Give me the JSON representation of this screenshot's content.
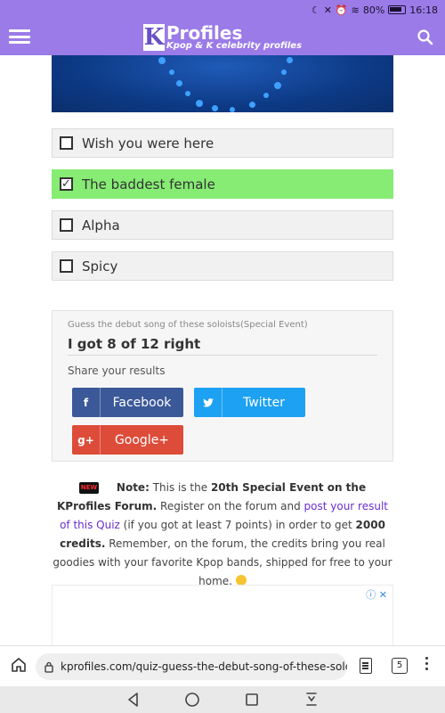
{
  "statusbar": {
    "battery": "80%",
    "time": "16:18"
  },
  "header": {
    "logo_letter": "K",
    "logo_name": "Profiles",
    "logo_tagline": "Kpop & K celebrity profiles"
  },
  "options": [
    {
      "label": "Wish you were here",
      "checked": false
    },
    {
      "label": "The baddest female",
      "checked": true
    },
    {
      "label": "Alpha",
      "checked": false
    },
    {
      "label": "Spicy",
      "checked": false
    }
  ],
  "result": {
    "quiz_title": "Guess the debut song of these soloists(Special Event)",
    "score_text": "I got 8 of 12 right",
    "share_label": "Share your results",
    "buttons": {
      "facebook": "Facebook",
      "twitter": "Twitter",
      "googleplus": "Google+"
    }
  },
  "note": {
    "badge": "NEW",
    "lead": "Note:",
    "text1": " This is the ",
    "bold1": "20th Special Event on the KProfiles Forum.",
    "text2": " Register on the forum and ",
    "link": "post your result of this Quiz",
    "text3": " (if you got at least 7 points) in order to get ",
    "bold2": "2000 credits.",
    "text4": " Remember, on the forum, the credits bring you real goodies with your favorite Kpop bands, shipped for free to your home. "
  },
  "browser": {
    "url": "kprofiles.com/quiz-guess-the-debut-song-of-these-soloists-sp",
    "tab_count": "5"
  },
  "colors": {
    "brand": "#9b7be8",
    "selected": "#86ec74",
    "facebook": "#3b5998",
    "twitter": "#1da1f2",
    "googleplus": "#dd4b39"
  }
}
